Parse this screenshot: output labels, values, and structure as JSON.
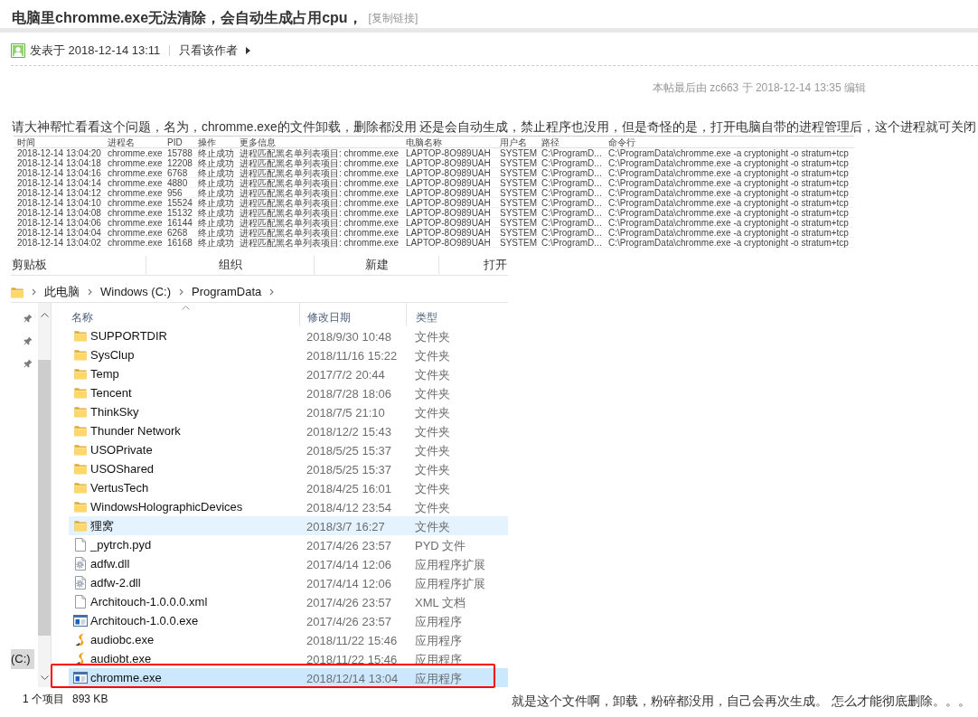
{
  "post": {
    "title": "电脑里chromme.exe无法清除，会自动生成占用cpu，",
    "copy_link": "[复制链接]",
    "posted": "发表于 2018-12-14 13:11",
    "author_only": "只看该作者",
    "edit_note": "本帖最后由 zc663 于 2018-12-14 13:35 编辑",
    "body": "请大神帮忙看看这个问题，名为，chromme.exe的文件卸载，删除都没用 还是会自动生成，禁止程序也没用，但是奇怪的是，打开电脑自带的进程管理后，这个进程就可关闭"
  },
  "log_screenshot": {
    "columns": [
      "时间",
      "进程名",
      "PID",
      "操作",
      "更多信息",
      "电脑名称",
      "用户名",
      "路径",
      "命令行"
    ],
    "rows": [
      [
        "2018-12-14 13:04:20",
        "chromme.exe",
        "15788",
        "终止成功",
        "进程匹配黑名单列表项目: chromme.exe",
        "LAPTOP-8O989UAH",
        "SYSTEM",
        "C:\\ProgramD...",
        "C:\\ProgramData\\chromme.exe -a cryptonight -o stratum+tcp"
      ],
      [
        "2018-12-14 13:04:18",
        "chromme.exe",
        "12208",
        "终止成功",
        "进程匹配黑名单列表项目: chromme.exe",
        "LAPTOP-8O989UAH",
        "SYSTEM",
        "C:\\ProgramD...",
        "C:\\ProgramData\\chromme.exe -a cryptonight -o stratum+tcp"
      ],
      [
        "2018-12-14 13:04:16",
        "chromme.exe",
        "6768",
        "终止成功",
        "进程匹配黑名单列表项目: chromme.exe",
        "LAPTOP-8O989UAH",
        "SYSTEM",
        "C:\\ProgramD...",
        "C:\\ProgramData\\chromme.exe -a cryptonight -o stratum+tcp"
      ],
      [
        "2018-12-14 13:04:14",
        "chromme.exe",
        "4880",
        "终止成功",
        "进程匹配黑名单列表项目: chromme.exe",
        "LAPTOP-8O989UAH",
        "SYSTEM",
        "C:\\ProgramD...",
        "C:\\ProgramData\\chromme.exe -a cryptonight -o stratum+tcp"
      ],
      [
        "2018-12-14 13:04:12",
        "chromme.exe",
        "956",
        "终止成功",
        "进程匹配黑名单列表项目: chromme.exe",
        "LAPTOP-8O989UAH",
        "SYSTEM",
        "C:\\ProgramD...",
        "C:\\ProgramData\\chromme.exe -a cryptonight -o stratum+tcp"
      ],
      [
        "2018-12-14 13:04:10",
        "chromme.exe",
        "15524",
        "终止成功",
        "进程匹配黑名单列表项目: chromme.exe",
        "LAPTOP-8O989UAH",
        "SYSTEM",
        "C:\\ProgramD...",
        "C:\\ProgramData\\chromme.exe -a cryptonight -o stratum+tcp"
      ],
      [
        "2018-12-14 13:04:08",
        "chromme.exe",
        "15132",
        "终止成功",
        "进程匹配黑名单列表项目: chromme.exe",
        "LAPTOP-8O989UAH",
        "SYSTEM",
        "C:\\ProgramD...",
        "C:\\ProgramData\\chromme.exe -a cryptonight -o stratum+tcp"
      ],
      [
        "2018-12-14 13:04:06",
        "chromme.exe",
        "16144",
        "终止成功",
        "进程匹配黑名单列表项目: chromme.exe",
        "LAPTOP-8O989UAH",
        "SYSTEM",
        "C:\\ProgramD...",
        "C:\\ProgramData\\chromme.exe -a cryptonight -o stratum+tcp"
      ],
      [
        "2018-12-14 13:04:04",
        "chromme.exe",
        "6268",
        "终止成功",
        "进程匹配黑名单列表项目: chromme.exe",
        "LAPTOP-8O989UAH",
        "SYSTEM",
        "C:\\ProgramD...",
        "C:\\ProgramData\\chromme.exe -a cryptonight -o stratum+tcp"
      ],
      [
        "2018-12-14 13:04:02",
        "chromme.exe",
        "16168",
        "终止成功",
        "进程匹配黑名单列表项目: chromme.exe",
        "LAPTOP-8O989UAH",
        "SYSTEM",
        "C:\\ProgramD...",
        "C:\\ProgramData\\chromme.exe -a cryptonight -o stratum+tcp"
      ]
    ]
  },
  "explorer_screenshot": {
    "ribbon_groups": [
      "剪贴板",
      "组织",
      "新建",
      "打开"
    ],
    "breadcrumb": [
      "此电脑",
      "Windows (C:)",
      "ProgramData"
    ],
    "nav": [
      {
        "label": "(C:)",
        "selected": true
      }
    ],
    "columns": [
      "名称",
      "修改日期",
      "类型"
    ],
    "files": [
      {
        "name": "SUPPORTDIR",
        "date": "2018/9/30 10:48",
        "type": "文件夹",
        "kind": "folder",
        "selected": false,
        "hovered": false,
        "annotated": false
      },
      {
        "name": "SysClup",
        "date": "2018/11/16 15:22",
        "type": "文件夹",
        "kind": "folder",
        "selected": false,
        "hovered": false,
        "annotated": false
      },
      {
        "name": "Temp",
        "date": "2017/7/2 20:44",
        "type": "文件夹",
        "kind": "folder",
        "selected": false,
        "hovered": false,
        "annotated": false
      },
      {
        "name": "Tencent",
        "date": "2018/7/28 18:06",
        "type": "文件夹",
        "kind": "folder",
        "selected": false,
        "hovered": false,
        "annotated": false
      },
      {
        "name": "ThinkSky",
        "date": "2018/7/5 21:10",
        "type": "文件夹",
        "kind": "folder",
        "selected": false,
        "hovered": false,
        "annotated": false
      },
      {
        "name": "Thunder Network",
        "date": "2018/12/2 15:43",
        "type": "文件夹",
        "kind": "folder",
        "selected": false,
        "hovered": false,
        "annotated": false
      },
      {
        "name": "USOPrivate",
        "date": "2018/5/25 15:37",
        "type": "文件夹",
        "kind": "folder",
        "selected": false,
        "hovered": false,
        "annotated": false
      },
      {
        "name": "USOShared",
        "date": "2018/5/25 15:37",
        "type": "文件夹",
        "kind": "folder",
        "selected": false,
        "hovered": false,
        "annotated": false
      },
      {
        "name": "VertusTech",
        "date": "2018/4/25 16:01",
        "type": "文件夹",
        "kind": "folder",
        "selected": false,
        "hovered": false,
        "annotated": false
      },
      {
        "name": "WindowsHolographicDevices",
        "date": "2018/4/12 23:54",
        "type": "文件夹",
        "kind": "folder",
        "selected": false,
        "hovered": false,
        "annotated": false
      },
      {
        "name": "狸窝",
        "date": "2018/3/7 16:27",
        "type": "文件夹",
        "kind": "folder",
        "selected": false,
        "hovered": true,
        "annotated": false
      },
      {
        "name": "_pytrch.pyd",
        "date": "2017/4/26 23:57",
        "type": "PYD 文件",
        "kind": "file",
        "selected": false,
        "hovered": false,
        "annotated": false
      },
      {
        "name": "adfw.dll",
        "date": "2017/4/14 12:06",
        "type": "应用程序扩展",
        "kind": "dll",
        "selected": false,
        "hovered": false,
        "annotated": false
      },
      {
        "name": "adfw-2.dll",
        "date": "2017/4/14 12:06",
        "type": "应用程序扩展",
        "kind": "dll",
        "selected": false,
        "hovered": false,
        "annotated": false
      },
      {
        "name": "Architouch-1.0.0.0.xml",
        "date": "2017/4/26 23:57",
        "type": "XML 文档",
        "kind": "file",
        "selected": false,
        "hovered": false,
        "annotated": false
      },
      {
        "name": "Architouch-1.0.0.exe",
        "date": "2017/4/26 23:57",
        "type": "应用程序",
        "kind": "app",
        "selected": false,
        "hovered": false,
        "annotated": false
      },
      {
        "name": "audiobc.exe",
        "date": "2018/11/22 15:46",
        "type": "应用程序",
        "kind": "audio",
        "selected": false,
        "hovered": false,
        "annotated": false
      },
      {
        "name": "audiobt.exe",
        "date": "2018/11/22 15:46",
        "type": "应用程序",
        "kind": "audio",
        "selected": false,
        "hovered": false,
        "annotated": false
      },
      {
        "name": "chromme.exe",
        "date": "2018/12/14 13:04",
        "type": "应用程序",
        "kind": "app",
        "selected": true,
        "hovered": false,
        "annotated": true
      }
    ],
    "status_bar": {
      "items": "1 个项目",
      "size": "893 KB"
    }
  },
  "closing": "就是这个文件啊，卸载，粉碎都没用，自己会再次生成。 怎么才能彻底删除。。。"
}
